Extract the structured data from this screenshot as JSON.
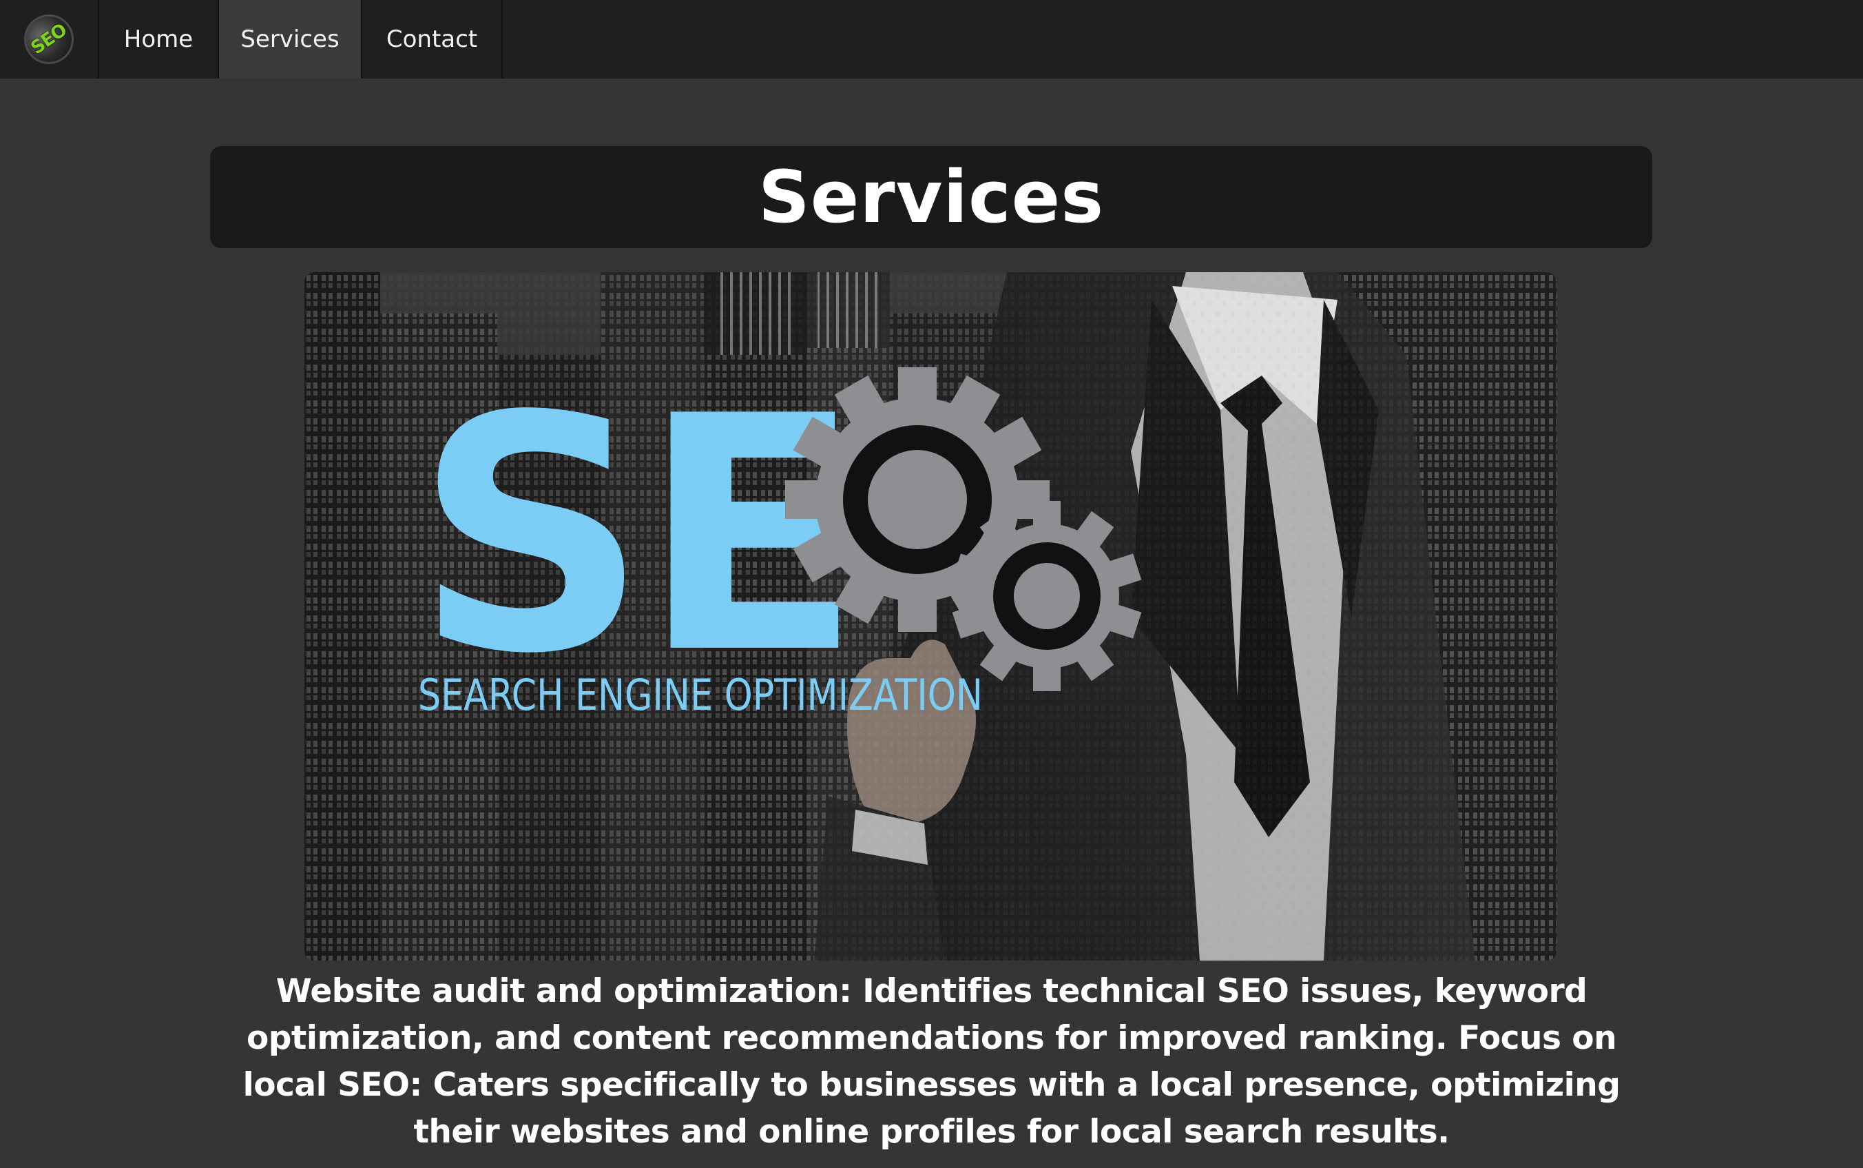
{
  "nav": {
    "logo_text": "SEO",
    "items": [
      {
        "label": "Home"
      },
      {
        "label": "Services"
      },
      {
        "label": "Contact"
      }
    ],
    "active_index": 1
  },
  "page": {
    "title": "Services"
  },
  "hero": {
    "big_letters": "SE",
    "subtitle": "SEARCH ENGINE OPTIMIZATION",
    "icon": "gears-icon",
    "accent_color": "#7ccdf6",
    "gear_color": "#8e8f92"
  },
  "description": "Website audit and optimization: Identifies technical SEO issues, keyword optimization, and content recommendations for improved ranking. Focus on local SEO: Caters specifically to businesses with a local presence, optimizing their websites and online profiles for local search results.",
  "colors": {
    "background": "#353535",
    "navbar": "#1e1f21",
    "nav_active": "#3a3b3d",
    "title_bar": "#1a1a1a",
    "logo_green": "#7ed321"
  }
}
